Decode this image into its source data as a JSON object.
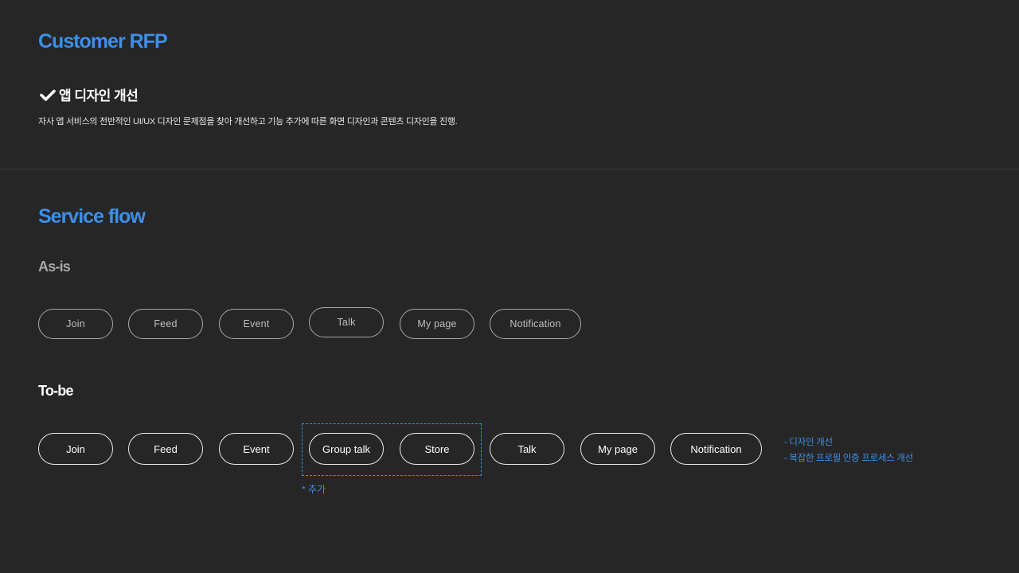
{
  "customer_rfp": {
    "title": "Customer RFP",
    "heading": "앱 디자인 개선",
    "description": "자사 앱 서비스의 전반적인 UI/UX 디자인 문제점을 찾아 개선하고 기능 추가에 따른 화면 디자인과 콘텐츠 디자인을 진행."
  },
  "service_flow": {
    "title": "Service flow",
    "as_is": {
      "label": "As-is",
      "steps": [
        "Join",
        "Feed",
        "Event",
        "Talk",
        "My page",
        "Notification"
      ]
    },
    "to_be": {
      "label": "To-be",
      "steps": [
        "Join",
        "Feed",
        "Event",
        "Group talk",
        "Store",
        "Talk",
        "My page",
        "Notification"
      ],
      "added_note": "* 추가",
      "notes": [
        "- 디자인 개선",
        "- 복잡한 프로필 인증 프로세스 개선"
      ]
    }
  },
  "colors": {
    "background": "#262626",
    "accent": "#3d8fe8",
    "divider": "#3d3d3d"
  },
  "icons": {
    "heading_icon": "check-icon"
  }
}
